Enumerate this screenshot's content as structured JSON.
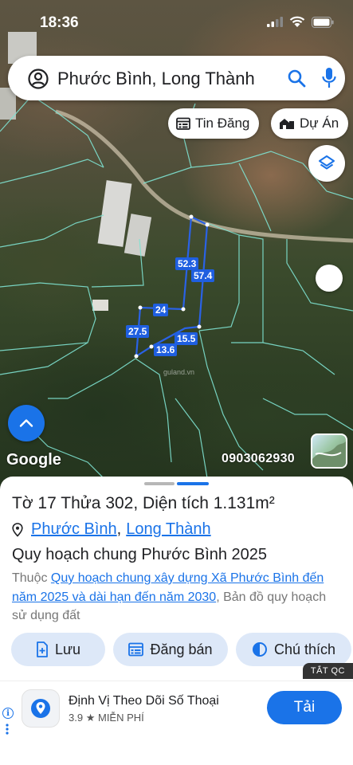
{
  "status": {
    "time": "18:36"
  },
  "search": {
    "query": "Phước Bình, Long Thành"
  },
  "chips": {
    "listings": "Tin Đăng",
    "projects": "Dự Án"
  },
  "map": {
    "measurements": [
      "52.3",
      "57.4",
      "24",
      "27.5",
      "15.5",
      "13.6"
    ],
    "google_logo": "Google",
    "phone": "0903062930",
    "watermark": "guland.vn"
  },
  "sheet": {
    "title": "Tờ 17 Thửa 302, Diện tích 1.131m²",
    "location": {
      "commune": "Phước Bình",
      "district": "Long Thành"
    },
    "plan_title": "Quy hoạch chung Phước Bình 2025",
    "desc_prefix": "Thuộc ",
    "desc_link": "Quy hoạch chung xây dựng Xã Phước Bình đến năm 2025 và dài hạn đến năm 2030",
    "desc_suffix": ", Bản đồ quy hoạch sử dụng đất",
    "actions": {
      "save": "Lưu",
      "post_sale": "Đăng bán",
      "legend": "Chú thích"
    },
    "ad_off": "TẮT QC"
  },
  "ad": {
    "title": "Định Vị Theo Dõi Số Thoại",
    "rating": "3.9",
    "price": "MIỄN PHÍ",
    "cta": "Tải"
  },
  "colors": {
    "accent": "#1a73e8",
    "measure_line": "#1f5fe0",
    "parcel_line": "#7fe3d2"
  }
}
